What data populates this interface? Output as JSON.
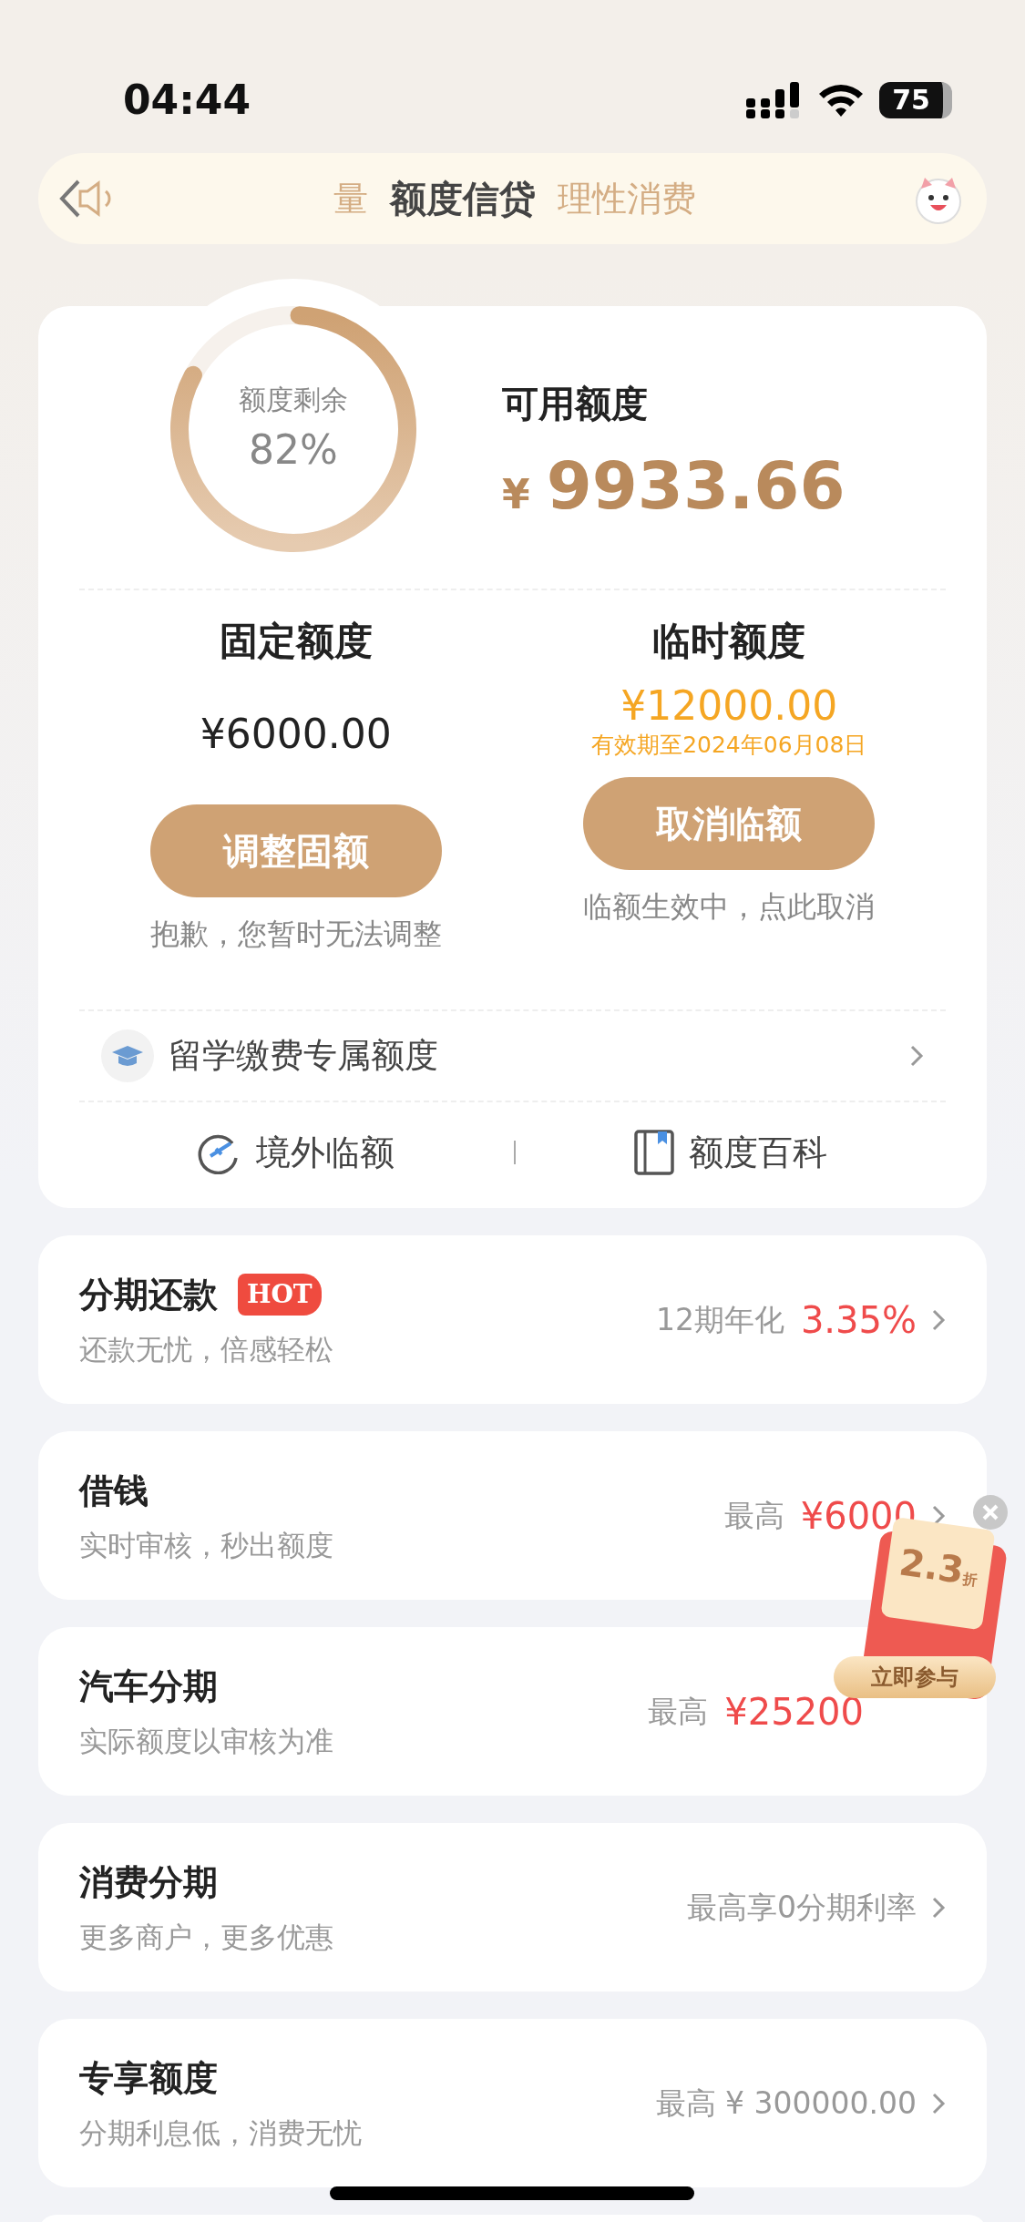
{
  "status_bar": {
    "time": "04:44",
    "battery": "75"
  },
  "header": {
    "title": "额度信贷",
    "notice_fragments": [
      "量",
      "理性消费"
    ]
  },
  "credit": {
    "ring_label": "额度剩余",
    "ring_value": "82%",
    "level": 0.82,
    "available_label": "可用额度",
    "currency": "¥",
    "available_amount": "9933.66",
    "columns": [
      {
        "kind": "fixed",
        "title": "固定额度",
        "amount": "¥6000.00",
        "button": "调整固额",
        "note": "抱歉，您暂时无法调整"
      },
      {
        "kind": "temporary",
        "title": "临时额度",
        "amount": "¥12000.00",
        "validity": "有效期至2024年06月08日",
        "button": "取消临额",
        "note": "临额生效中，点此取消"
      }
    ],
    "study_row": {
      "label": "留学缴费专属额度"
    },
    "links": [
      {
        "label": "境外临额"
      },
      {
        "label": "额度百科"
      }
    ]
  },
  "products": [
    {
      "title": "分期还款",
      "badge": "HOT",
      "subtitle": "还款无忧，倍感轻松",
      "right_label": "12期年化",
      "right_value": "3.35%",
      "chevron": true
    },
    {
      "title": "借钱",
      "subtitle": "实时审核，秒出额度",
      "right_label": "最高",
      "right_value": "¥6000",
      "chevron": true
    },
    {
      "title": "汽车分期",
      "subtitle": "实际额度以审核为准",
      "right_label": "最高",
      "right_value": "¥25200",
      "chevron": false
    },
    {
      "title": "消费分期",
      "subtitle": "更多商户，更多优惠",
      "right_label": "最高享0分期利率",
      "chevron": true
    },
    {
      "title": "专享额度",
      "subtitle": "分期利息低，消费无忧",
      "right_label": "最高 ¥ 300000.00",
      "chevron": true
    }
  ],
  "promo": {
    "discount": "2.3",
    "unit": "折",
    "button": "立即参与"
  }
}
